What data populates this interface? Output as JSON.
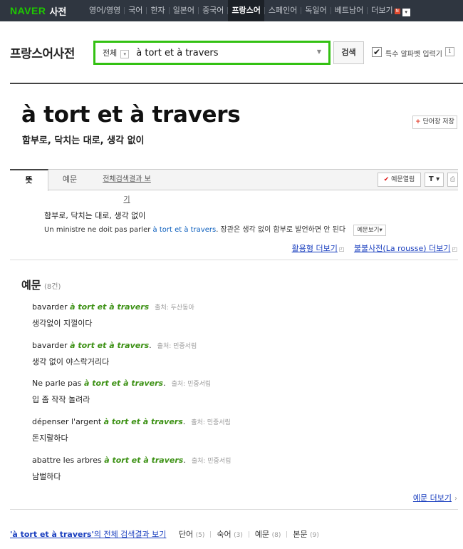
{
  "nav": {
    "logo_naver": "NAVER",
    "logo_dict": "사전",
    "items": [
      "영어/영영",
      "국어",
      "한자",
      "일본어",
      "중국어",
      "프랑스어",
      "스페인어",
      "독일어",
      "베트남어",
      "더보기"
    ],
    "active_item": "프랑스어",
    "more_badge": "N",
    "more_arrow": "▾"
  },
  "search": {
    "dict_title": "프랑스어사전",
    "scope": "전체",
    "scope_arrow": "▾",
    "query": "à tort et à travers",
    "dropdown_arrow": "▼",
    "button": "검색",
    "special_checked": "✔",
    "special_label": "특수 알파벳 입력기",
    "info": "i"
  },
  "entry": {
    "word": "à tort et à travers",
    "meaning": "함부로, 닥치는 대로, 생각 없이",
    "wordbook_plus": "+",
    "wordbook_label": "단어장 저장"
  },
  "tabs": {
    "meaning": "뜻",
    "examples": "예문",
    "all_results": "전체검색결과 보기",
    "example_toggle_check": "✔",
    "example_toggle_label": "예문열림",
    "font_button": "T ▾",
    "print_icon": "⎙"
  },
  "definition": {
    "ko": "함부로, 닥치는 대로, 생각 없이",
    "fr_before": "Un ministre ne doit pas parler ",
    "fr_highlight": "à tort et à travers",
    "fr_after": ". 장관은 생각 없이 함부로 발언하면 안 된다",
    "example_view": "예문보기▾",
    "link_conjugation": "활용형 더보기",
    "link_larousse": "불불사전(La rousse) 더보기"
  },
  "examples": {
    "heading": "예문",
    "count": "(8건)",
    "items": [
      {
        "fr_before": "bavarder ",
        "fr_hl": "à tort et à travers",
        "fr_after": "",
        "source": "출처: 두산동아",
        "ko": "생각없이 지껄이다"
      },
      {
        "fr_before": "bavarder ",
        "fr_hl": "à tort et à travers",
        "fr_after": ".",
        "source": "출처: 민중서림",
        "ko": "생각 없이 야스락거리다"
      },
      {
        "fr_before": "Ne parle pas ",
        "fr_hl": "à tort et à travers",
        "fr_after": ".",
        "source": "출처: 민중서림",
        "ko": "입 좀 작작 놀려라"
      },
      {
        "fr_before": "dépenser l'argent ",
        "fr_hl": "à tort et à travers",
        "fr_after": ".",
        "source": "출처: 민중서림",
        "ko": "돈지랄하다"
      },
      {
        "fr_before": "abattre les arbres ",
        "fr_hl": "à tort et à travers",
        "fr_after": ".",
        "source": "출처: 민중서림",
        "ko": "남벌하다"
      }
    ],
    "more_link": "예문 더보기",
    "more_chevron": "›"
  },
  "footer": {
    "query_quoted": "'à tort et à travers'",
    "all_results_suffix": "의 전체 검색결과 보기",
    "categories": [
      {
        "label": "단어",
        "count": "(5)"
      },
      {
        "label": "숙어",
        "count": "(3)"
      },
      {
        "label": "예문",
        "count": "(8)"
      },
      {
        "label": "본문",
        "count": "(9)"
      }
    ]
  }
}
